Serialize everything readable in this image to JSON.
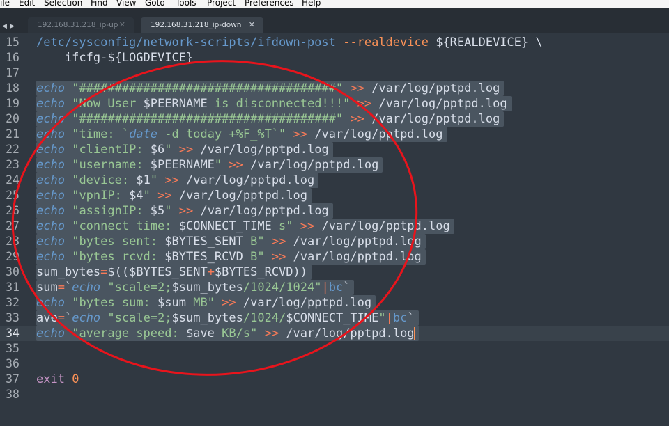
{
  "menu": [
    "ile",
    "Edit",
    "Selection",
    "Find",
    "View",
    "Goto",
    "Tools",
    "Project",
    "Preferences",
    "Help"
  ],
  "tabs": [
    {
      "label": "192.168.31.218_ip-up",
      "close": "✕",
      "active": false
    },
    {
      "label": "192.168.31.218_ip-down",
      "close": "✕",
      "active": true
    }
  ],
  "nav_arrows": {
    "left": "◀",
    "right": "▶"
  },
  "current_line": "34",
  "lines": [
    {
      "n": "15",
      "segs": [
        [
          "t-path-blue",
          "/etc/sysconfig/network-scripts/ifdown-post"
        ],
        [
          "t-plain",
          " "
        ],
        [
          "t-num",
          "--realdevice"
        ],
        [
          "t-plain",
          " ${REALDEVICE} \\"
        ]
      ]
    },
    {
      "n": "16",
      "segs": [
        [
          "t-plain",
          "    ifcfg-${LOGDEVICE}"
        ]
      ]
    },
    {
      "n": "17",
      "segs": []
    },
    {
      "n": "18",
      "segs": [
        [
          "t-cmd",
          "echo"
        ],
        [
          "t-plain",
          " "
        ],
        [
          "t-str",
          "\"####################################\""
        ],
        [
          "t-plain",
          " "
        ],
        [
          "t-op",
          ">>"
        ],
        [
          "t-plain",
          " /var/log/pptpd.log"
        ]
      ]
    },
    {
      "n": "19",
      "segs": [
        [
          "t-cmd",
          "echo"
        ],
        [
          "t-plain",
          " "
        ],
        [
          "t-str",
          "\"Now User "
        ],
        [
          "t-var",
          "$PEERNAME"
        ],
        [
          "t-str",
          " is disconnected!!!\""
        ],
        [
          "t-plain",
          " "
        ],
        [
          "t-op",
          ">>"
        ],
        [
          "t-plain",
          " /var/log/pptpd.log"
        ]
      ]
    },
    {
      "n": "20",
      "segs": [
        [
          "t-cmd",
          "echo"
        ],
        [
          "t-plain",
          " "
        ],
        [
          "t-str",
          "\"####################################\""
        ],
        [
          "t-plain",
          " "
        ],
        [
          "t-op",
          ">>"
        ],
        [
          "t-plain",
          " /var/log/pptpd.log"
        ]
      ]
    },
    {
      "n": "21",
      "segs": [
        [
          "t-cmd",
          "echo"
        ],
        [
          "t-plain",
          " "
        ],
        [
          "t-str",
          "\"time: `"
        ],
        [
          "t-cmd",
          "date"
        ],
        [
          "t-str",
          " -d today +%F_%T`\""
        ],
        [
          "t-plain",
          " "
        ],
        [
          "t-op",
          ">>"
        ],
        [
          "t-plain",
          " /var/log/pptpd.log"
        ]
      ]
    },
    {
      "n": "22",
      "segs": [
        [
          "t-cmd",
          "echo"
        ],
        [
          "t-plain",
          " "
        ],
        [
          "t-str",
          "\"clientIP: "
        ],
        [
          "t-var",
          "$6"
        ],
        [
          "t-str",
          "\""
        ],
        [
          "t-plain",
          " "
        ],
        [
          "t-op",
          ">>"
        ],
        [
          "t-plain",
          " /var/log/pptpd.log"
        ]
      ]
    },
    {
      "n": "23",
      "segs": [
        [
          "t-cmd",
          "echo"
        ],
        [
          "t-plain",
          " "
        ],
        [
          "t-str",
          "\"username: "
        ],
        [
          "t-var",
          "$PEERNAME"
        ],
        [
          "t-str",
          "\""
        ],
        [
          "t-plain",
          " "
        ],
        [
          "t-op",
          ">>"
        ],
        [
          "t-plain",
          " /var/log/pptpd.log"
        ]
      ]
    },
    {
      "n": "24",
      "segs": [
        [
          "t-cmd",
          "echo"
        ],
        [
          "t-plain",
          " "
        ],
        [
          "t-str",
          "\"device: "
        ],
        [
          "t-var",
          "$1"
        ],
        [
          "t-str",
          "\""
        ],
        [
          "t-plain",
          " "
        ],
        [
          "t-op",
          ">>"
        ],
        [
          "t-plain",
          " /var/log/pptpd.log"
        ]
      ]
    },
    {
      "n": "25",
      "segs": [
        [
          "t-cmd",
          "echo"
        ],
        [
          "t-plain",
          " "
        ],
        [
          "t-str",
          "\"vpnIP: "
        ],
        [
          "t-var",
          "$4"
        ],
        [
          "t-str",
          "\""
        ],
        [
          "t-plain",
          " "
        ],
        [
          "t-op",
          ">>"
        ],
        [
          "t-plain",
          " /var/log/pptpd.log"
        ]
      ]
    },
    {
      "n": "26",
      "segs": [
        [
          "t-cmd",
          "echo"
        ],
        [
          "t-plain",
          " "
        ],
        [
          "t-str",
          "\"assignIP: "
        ],
        [
          "t-var",
          "$5"
        ],
        [
          "t-str",
          "\""
        ],
        [
          "t-plain",
          " "
        ],
        [
          "t-op",
          ">>"
        ],
        [
          "t-plain",
          " /var/log/pptpd.log"
        ]
      ]
    },
    {
      "n": "27",
      "segs": [
        [
          "t-cmd",
          "echo"
        ],
        [
          "t-plain",
          " "
        ],
        [
          "t-str",
          "\"connect time: "
        ],
        [
          "t-var",
          "$CONNECT_TIME"
        ],
        [
          "t-str",
          " s\""
        ],
        [
          "t-plain",
          " "
        ],
        [
          "t-op",
          ">>"
        ],
        [
          "t-plain",
          " /var/log/pptpd.log"
        ]
      ]
    },
    {
      "n": "28",
      "segs": [
        [
          "t-cmd",
          "echo"
        ],
        [
          "t-plain",
          " "
        ],
        [
          "t-str",
          "\"bytes sent: "
        ],
        [
          "t-var",
          "$BYTES_SENT"
        ],
        [
          "t-str",
          " B\""
        ],
        [
          "t-plain",
          " "
        ],
        [
          "t-op",
          ">>"
        ],
        [
          "t-plain",
          " /var/log/pptpd.log"
        ]
      ]
    },
    {
      "n": "29",
      "segs": [
        [
          "t-cmd",
          "echo"
        ],
        [
          "t-plain",
          " "
        ],
        [
          "t-str",
          "\"bytes rcvd: "
        ],
        [
          "t-var",
          "$BYTES_RCVD"
        ],
        [
          "t-str",
          " B\""
        ],
        [
          "t-plain",
          " "
        ],
        [
          "t-op",
          ">>"
        ],
        [
          "t-plain",
          " /var/log/pptpd.log"
        ]
      ]
    },
    {
      "n": "30",
      "segs": [
        [
          "t-plain",
          "sum_bytes"
        ],
        [
          "t-op",
          "="
        ],
        [
          "t-plain",
          "$(("
        ],
        [
          "t-var",
          "$BYTES_SENT"
        ],
        [
          "t-op",
          "+"
        ],
        [
          "t-var",
          "$BYTES_RCVD"
        ],
        [
          "t-plain",
          "))"
        ]
      ]
    },
    {
      "n": "31",
      "segs": [
        [
          "t-plain",
          "sum"
        ],
        [
          "t-op",
          "="
        ],
        [
          "t-plain",
          "`"
        ],
        [
          "t-cmd",
          "echo"
        ],
        [
          "t-plain",
          " "
        ],
        [
          "t-str",
          "\"scale=2;"
        ],
        [
          "t-var",
          "$sum_bytes"
        ],
        [
          "t-str",
          "/1024/1024\""
        ],
        [
          "t-op",
          "|"
        ],
        [
          "t-path-blue",
          "bc"
        ],
        [
          "t-plain",
          "`"
        ]
      ]
    },
    {
      "n": "32",
      "segs": [
        [
          "t-cmd",
          "echo"
        ],
        [
          "t-plain",
          " "
        ],
        [
          "t-str",
          "\"bytes sum: "
        ],
        [
          "t-var",
          "$sum"
        ],
        [
          "t-str",
          " MB\""
        ],
        [
          "t-plain",
          " "
        ],
        [
          "t-op",
          ">>"
        ],
        [
          "t-plain",
          " /var/log/pptpd.log"
        ]
      ]
    },
    {
      "n": "33",
      "segs": [
        [
          "t-plain",
          "ave"
        ],
        [
          "t-op",
          "="
        ],
        [
          "t-plain",
          "`"
        ],
        [
          "t-cmd",
          "echo"
        ],
        [
          "t-plain",
          " "
        ],
        [
          "t-str",
          "\"scale=2;"
        ],
        [
          "t-var",
          "$sum_bytes"
        ],
        [
          "t-str",
          "/1024/"
        ],
        [
          "t-var",
          "$CONNECT_TIME"
        ],
        [
          "t-str",
          "\""
        ],
        [
          "t-op",
          "|"
        ],
        [
          "t-path-blue",
          "bc"
        ],
        [
          "t-plain",
          "`"
        ]
      ]
    },
    {
      "n": "34",
      "segs": [
        [
          "t-cmd",
          "echo"
        ],
        [
          "t-plain",
          " "
        ],
        [
          "t-str",
          "\"average speed: "
        ],
        [
          "t-var",
          "$ave"
        ],
        [
          "t-str",
          " KB/s\""
        ],
        [
          "t-plain",
          " "
        ],
        [
          "t-op",
          ">>"
        ],
        [
          "t-plain",
          " /var/log/pptpd.log"
        ]
      ]
    },
    {
      "n": "35",
      "segs": []
    },
    {
      "n": "36",
      "segs": []
    },
    {
      "n": "37",
      "segs": [
        [
          "t-kw",
          "exit"
        ],
        [
          "t-plain",
          " "
        ],
        [
          "t-num",
          "0"
        ]
      ]
    },
    {
      "n": "38",
      "segs": []
    }
  ],
  "selected_lines": [
    "18",
    "19",
    "20",
    "21",
    "22",
    "23",
    "24",
    "25",
    "26",
    "27",
    "28",
    "29",
    "30",
    "31",
    "32",
    "33",
    "34"
  ],
  "colors": {
    "background": "#303841",
    "selection": "#4a5560",
    "annotation": "#e8141c"
  }
}
